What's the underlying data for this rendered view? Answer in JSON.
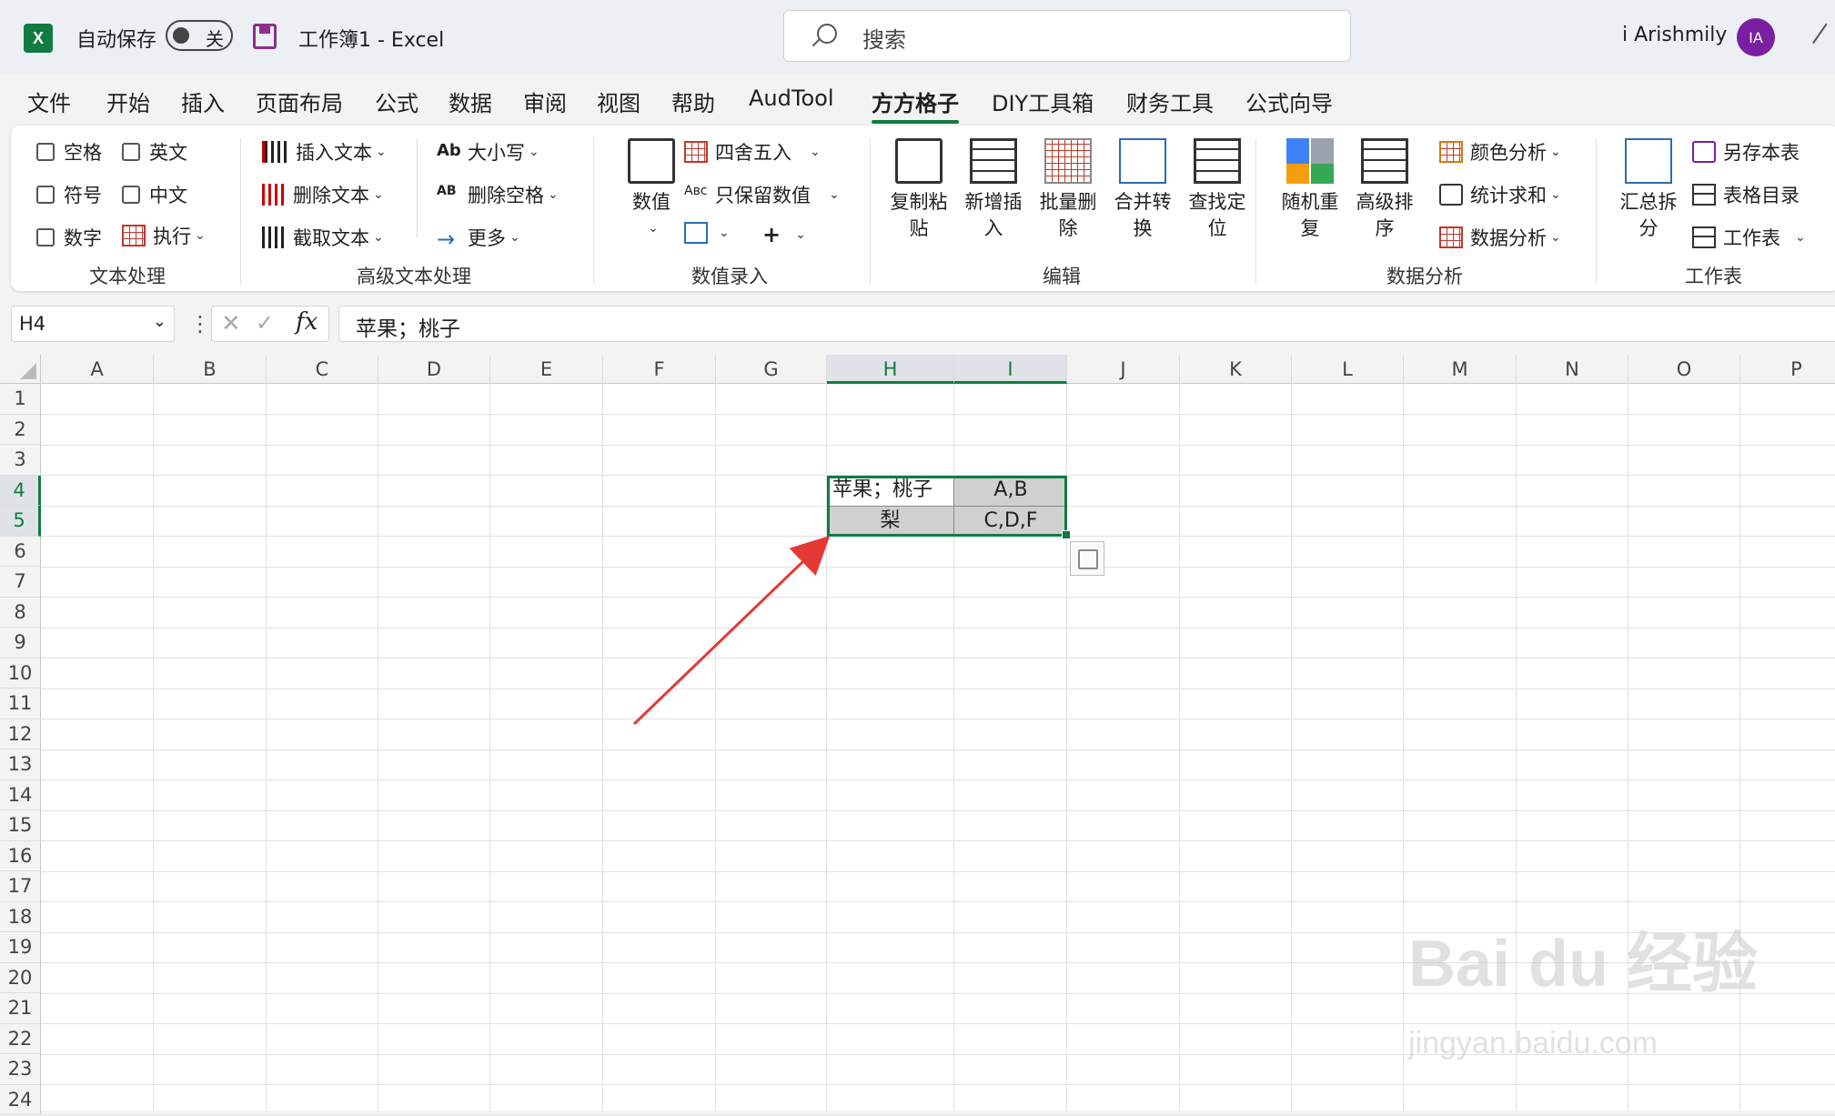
{
  "titlebar": {
    "app_logo": "X",
    "autosave_label": "自动保存",
    "autosave_state": "关",
    "document_title": "工作簿1  -  Excel",
    "search_placeholder": "搜索",
    "user_name": "i Arishmily",
    "user_initials": "IA"
  },
  "tabs": [
    "文件",
    "开始",
    "插入",
    "页面布局",
    "公式",
    "数据",
    "审阅",
    "视图",
    "帮助",
    "AudTool",
    "方方格子",
    "DIY工具箱",
    "财务工具",
    "公式向导"
  ],
  "active_tab": "方方格子",
  "ribbon": {
    "text_processing": {
      "label": "文本处理",
      "checkboxes": [
        "空格",
        "英文",
        "符号",
        "中文",
        "数字"
      ],
      "execute": "执行"
    },
    "advanced_text": {
      "label": "高级文本处理",
      "insert_text": "插入文本",
      "delete_text": "删除文本",
      "extract_text": "截取文本",
      "case": "大小写",
      "delete_spaces": "删除空格",
      "more": "更多"
    },
    "numeric_input": {
      "label": "数值录入",
      "value": "数值",
      "round": "四舍五入",
      "keep_numeric": "只保留数值"
    },
    "edit": {
      "label": "编辑",
      "copy_paste": "复制粘贴",
      "insert": "新增插入",
      "batch_delete": "批量删除",
      "merge": "合并转换",
      "find": "查找定位"
    },
    "data_analysis": {
      "label": "数据分析",
      "random": "随机重复",
      "sort": "高级排序",
      "color_analysis": "颜色分析",
      "stat_sum": "统计求和",
      "data_analysis": "数据分析"
    },
    "worksheet": {
      "label": "工作表",
      "split": "汇总拆分",
      "save_sheet": "另存本表",
      "table_index": "表格目录",
      "sheet": "工作表"
    }
  },
  "formula_bar": {
    "name_box": "H4",
    "fx": "fx",
    "content": "苹果；桃子"
  },
  "columns": [
    "A",
    "B",
    "C",
    "D",
    "E",
    "F",
    "G",
    "H",
    "I",
    "J",
    "K",
    "L",
    "M",
    "N",
    "O",
    "P"
  ],
  "rows": [
    "1",
    "2",
    "3",
    "4",
    "5",
    "6",
    "7",
    "8",
    "9",
    "10",
    "11",
    "12",
    "13",
    "14",
    "15",
    "16",
    "17",
    "18",
    "19",
    "20",
    "21",
    "22",
    "23",
    "24"
  ],
  "cells": {
    "H4": "苹果；桃子",
    "I4": "A,B",
    "H5": "梨",
    "I5": "C,D,F"
  },
  "watermark": {
    "main": "Bai du 经验",
    "sub": "jingyan.baidu.com"
  },
  "colors": {
    "accent": "#107c41",
    "arrow": "#e53935",
    "selected_fill": "#d0d0d0"
  }
}
